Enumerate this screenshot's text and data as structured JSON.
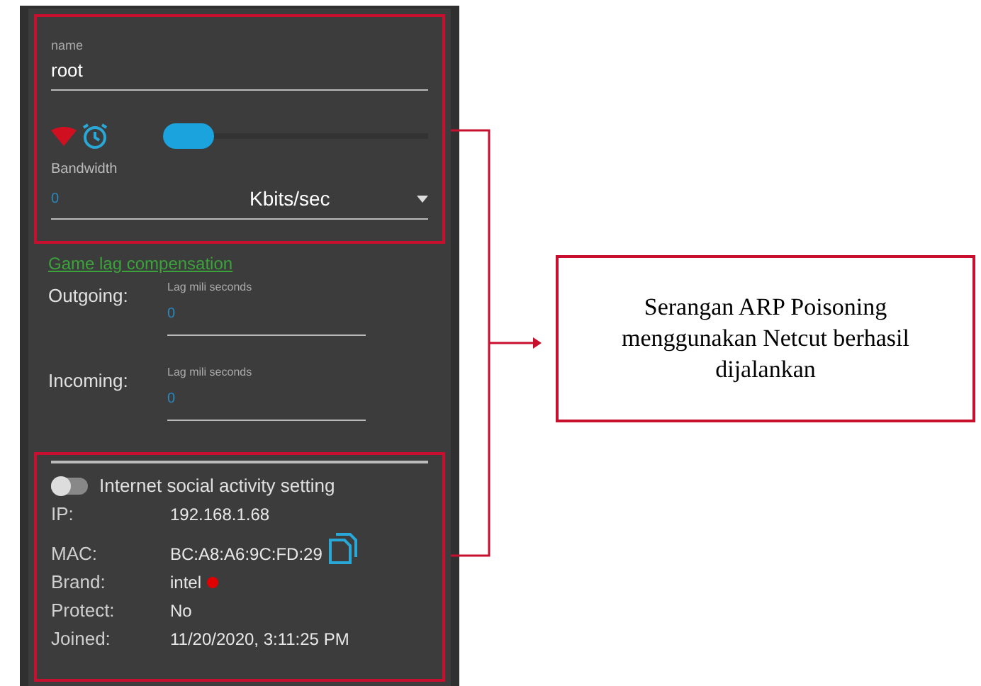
{
  "name_field": {
    "label": "name",
    "value": "root"
  },
  "bandwidth": {
    "label": "Bandwidth",
    "level": 0,
    "value": "0",
    "unit": "Kbits/sec"
  },
  "game_lag": {
    "title": "Game lag compensation",
    "rows": [
      {
        "label": "Outgoing:",
        "field_label": "Lag mili seconds",
        "value": "0"
      },
      {
        "label": "Incoming:",
        "field_label": "Lag mili seconds",
        "value": "0"
      }
    ]
  },
  "social": {
    "label": "Internet social activity setting",
    "on": false
  },
  "details": [
    {
      "kind": "plain",
      "label": "IP:",
      "value": "192.168.1.68"
    },
    {
      "kind": "copy",
      "label": "MAC:",
      "value": "BC:A8:A6:9C:FD:29"
    },
    {
      "kind": "dot",
      "label": "Brand:",
      "value": "intel"
    },
    {
      "kind": "plain",
      "label": "Protect:",
      "value": "No"
    },
    {
      "kind": "plain",
      "label": "Joined:",
      "value": "11/20/2020, 3:11:25 PM"
    }
  ],
  "callout": {
    "text": "Serangan ARP Poisoning menggunakan Netcut berhasil dijalankan"
  }
}
